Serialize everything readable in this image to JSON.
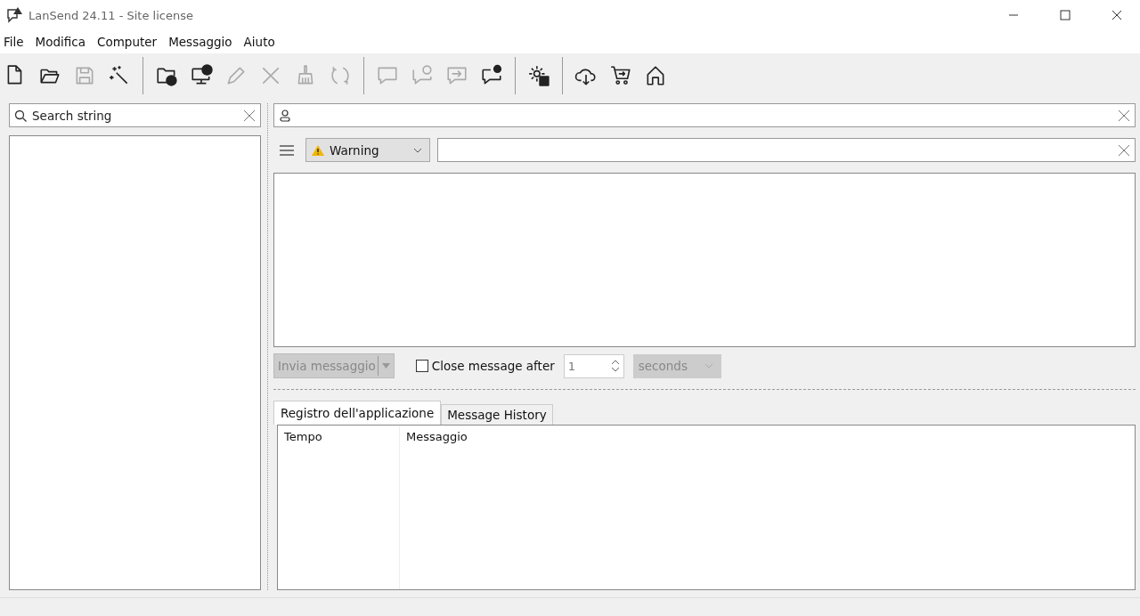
{
  "window": {
    "title": "LanSend 24.11 - Site license"
  },
  "menu": [
    "File",
    "Modifica",
    "Computer",
    "Messaggio",
    "Aiuto"
  ],
  "toolbar": [
    [
      {
        "kind": "new-file",
        "disabled": false
      },
      {
        "kind": "open-folder",
        "disabled": false
      },
      {
        "kind": "save",
        "disabled": true
      },
      {
        "kind": "wand",
        "disabled": false
      }
    ],
    [
      {
        "kind": "add-folder",
        "disabled": false
      },
      {
        "kind": "add-computer",
        "disabled": false
      },
      {
        "kind": "pencil",
        "disabled": true
      },
      {
        "kind": "delete",
        "disabled": true
      },
      {
        "kind": "broom",
        "disabled": true
      },
      {
        "kind": "refresh",
        "disabled": true
      }
    ],
    [
      {
        "kind": "chat",
        "disabled": true
      },
      {
        "kind": "chat-eye",
        "disabled": true
      },
      {
        "kind": "chat-forward",
        "disabled": true
      },
      {
        "kind": "chat-gear",
        "disabled": false
      }
    ],
    [
      {
        "kind": "gear-check",
        "disabled": false
      }
    ],
    [
      {
        "kind": "cloud-download",
        "disabled": false
      },
      {
        "kind": "cart",
        "disabled": false
      },
      {
        "kind": "home",
        "disabled": false
      }
    ]
  ],
  "search": {
    "placeholder": "Search string"
  },
  "message": {
    "level": "Warning",
    "send_button": "Invia messaggio",
    "send_disabled": true,
    "close_after": {
      "label": "Close message after",
      "checked": false,
      "value": "1",
      "unit": "seconds"
    }
  },
  "tabs": [
    {
      "label": "Registro dell'applicazione",
      "selected": true
    },
    {
      "label": "Message History",
      "selected": false
    }
  ],
  "table": {
    "columns": [
      "Tempo",
      "Messaggio"
    ]
  }
}
